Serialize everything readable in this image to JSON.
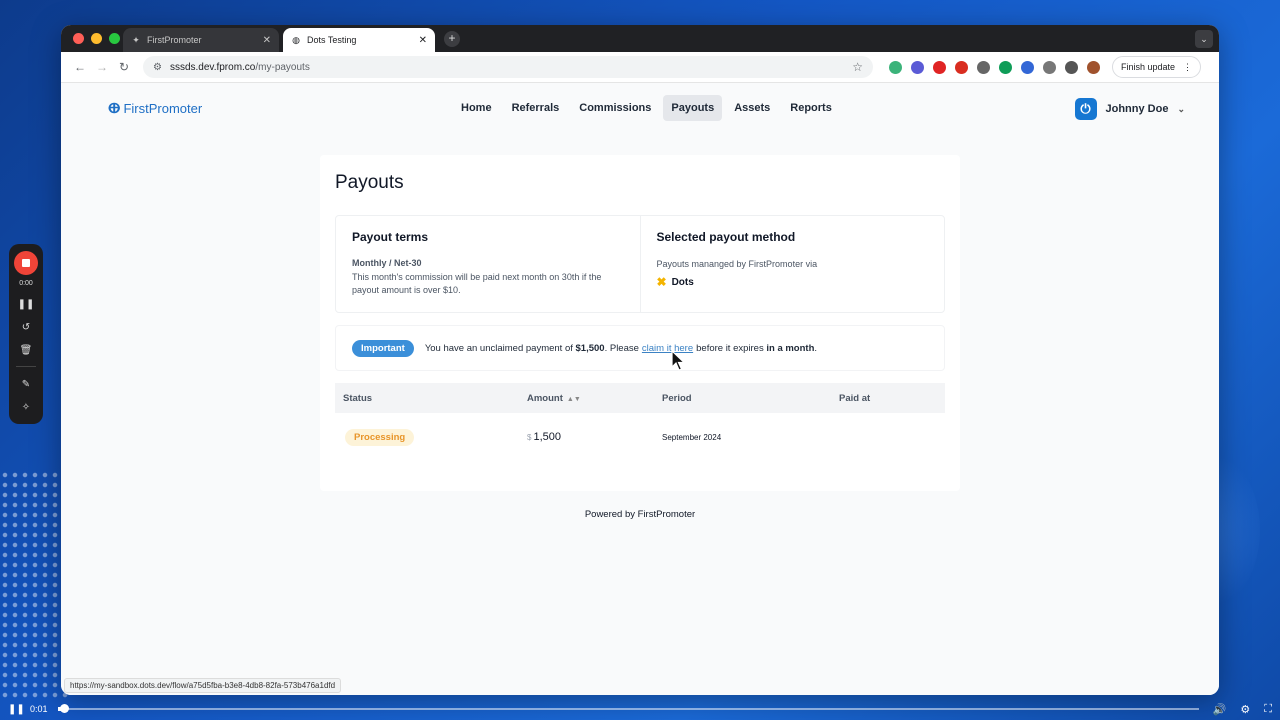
{
  "browser": {
    "tabs": [
      {
        "title": "FirstPromoter",
        "active": false
      },
      {
        "title": "Dots Testing",
        "active": true
      }
    ],
    "url_host": "sssds.dev.fprom.co",
    "url_path": "/my-payouts",
    "finish_update_label": "Finish update",
    "status_url": "https://my-sandbox.dots.dev/flow/a75d5fba-b3e8-4db8-82fa-573b476a1dfd"
  },
  "site": {
    "logo_text": "FirstPromoter",
    "nav": [
      {
        "label": "Home",
        "active": false
      },
      {
        "label": "Referrals",
        "active": false
      },
      {
        "label": "Commissions",
        "active": false
      },
      {
        "label": "Payouts",
        "active": true
      },
      {
        "label": "Assets",
        "active": false
      },
      {
        "label": "Reports",
        "active": false
      }
    ],
    "user_name": "Johnny Doe"
  },
  "payouts": {
    "title": "Payouts",
    "terms": {
      "heading": "Payout terms",
      "schedule": "Monthly / Net-30",
      "description": "This month's commission will be paid next month on 30th if the payout amount is over $10."
    },
    "method": {
      "heading": "Selected payout method",
      "description": "Payouts mananged by FirstPromoter via",
      "provider": "Dots"
    },
    "alert": {
      "badge": "Important",
      "text_before": "You have an unclaimed payment of",
      "amount": "$1,500",
      "text_please": ". Please",
      "link": "claim it here",
      "text_after": "before it expires",
      "expires": "in a month",
      "text_end": "."
    },
    "table": {
      "headers": {
        "status": "Status",
        "amount": "Amount",
        "period": "Period",
        "paid_at": "Paid at"
      },
      "rows": [
        {
          "status": "Processing",
          "currency": "$",
          "amount": "1,500",
          "period": "September 2024",
          "paid_at": ""
        }
      ]
    },
    "footer": "Powered by FirstPromoter"
  },
  "recorder": {
    "time": "0:00"
  },
  "video": {
    "time": "0:01",
    "progress": 0.006
  },
  "colors": {
    "accent": "#3b8fd9",
    "processing_bg": "#fdf3d8",
    "processing_fg": "#e8952a",
    "record_red": "#f04438"
  }
}
